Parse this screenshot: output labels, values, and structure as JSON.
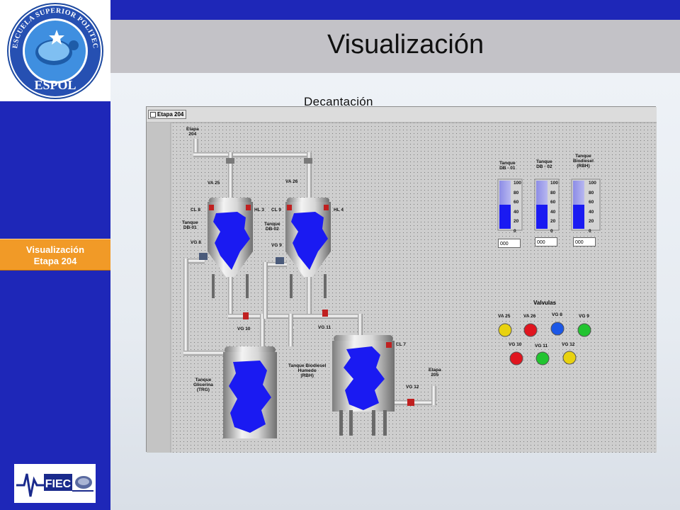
{
  "header": {
    "title": "Visualización"
  },
  "sidebar": {
    "nav_button_line1": "Visualización",
    "nav_button_line2": "Etapa 204",
    "logo_text_ring": "ESCUELA SUPERIOR POLITECNICA DEL LITORAL",
    "logo_text": "ESPOL",
    "footer_logo_text": "FIEC"
  },
  "main": {
    "section_title": "Decantación"
  },
  "scada": {
    "tab_label": "Etapa 204",
    "inlet_label_1": "Etapa",
    "inlet_label_2": "204",
    "outlet_label_1": "Etapa",
    "outlet_label_2": "205",
    "tank1": {
      "line1": "Tanque",
      "line2": "DB-01",
      "valve_top": "VA 25",
      "sensor_l": "CL 8",
      "sensor_r": "HL 3",
      "valve_side": "VG 8",
      "valve_bottom": "VG 10"
    },
    "tank2": {
      "line1": "Tanque",
      "line2": "DB-02",
      "valve_top": "VA 26",
      "sensor_l": "CL 9",
      "sensor_r": "HL 4",
      "valve_side": "VG 9",
      "valve_bottom": "VG 11"
    },
    "tank_glycerin": {
      "line1": "Tanque",
      "line2": "Glicerina",
      "line3": "(TRG)"
    },
    "tank_biodiesel": {
      "line1": "Tanque Biodiesel",
      "line2": "Humedo",
      "line3": "(RBH)",
      "sensor": "CL 7",
      "valve_out": "VG 12"
    },
    "gauges": [
      {
        "title1": "Tanque",
        "title2": "DB - 01",
        "title3": "",
        "level": 50,
        "readout": "000"
      },
      {
        "title1": "Tanque",
        "title2": "DB - 02",
        "title3": "",
        "level": 50,
        "readout": "000"
      },
      {
        "title1": "Tanque",
        "title2": "Biodiesel",
        "title3": "(RBH)",
        "level": 50,
        "readout": "000"
      }
    ],
    "gauge_ticks": [
      "100",
      "80",
      "60",
      "40",
      "20",
      "0"
    ],
    "valves_title": "Valvulas",
    "valves": [
      {
        "label": "VA 25",
        "color": "#e8d20f"
      },
      {
        "label": "VA 26",
        "color": "#e0151f"
      },
      {
        "label": "VG 8",
        "color": "#1b57e6"
      },
      {
        "label": "VG 9",
        "color": "#22c430"
      },
      {
        "label": "VG 10",
        "color": "#e0151f"
      },
      {
        "label": "VG 11",
        "color": "#22c430"
      },
      {
        "label": "VG 12",
        "color": "#e8d20f"
      }
    ]
  },
  "colors": {
    "sidebar": "#1e27b8",
    "nav_button": "#f19a27",
    "title_band": "#c3c2c7",
    "liquid": "#1a1af2"
  }
}
